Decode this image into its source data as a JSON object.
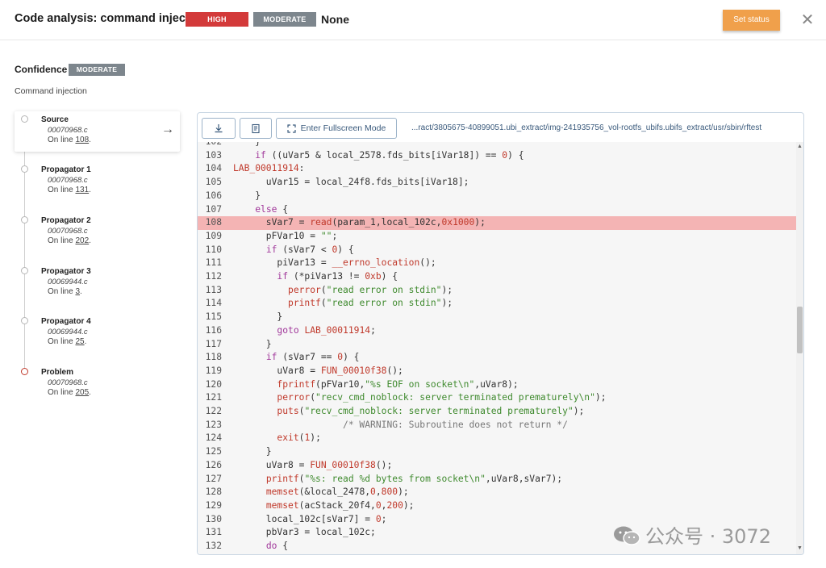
{
  "header": {
    "title": "Code analysis: command injection",
    "severity_badge": "HIGH",
    "moderate_badge": "MODERATE",
    "status_text": "None",
    "set_status_label": "Set status",
    "close_glyph": "✕"
  },
  "confidence": {
    "label": "Confidence",
    "badge": "MODERATE",
    "description": "Command injection"
  },
  "flow": {
    "items": [
      {
        "title": "Source",
        "file": "00070968.c",
        "line_prefix": "On line ",
        "line": "108",
        "active": true
      },
      {
        "title": "Propagator 1",
        "file": "00070968.c",
        "line_prefix": "On line ",
        "line": "131"
      },
      {
        "title": "Propagator 2",
        "file": "00070968.c",
        "line_prefix": "On line ",
        "line": "202"
      },
      {
        "title": "Propagator 3",
        "file": "00069944.c",
        "line_prefix": "On line ",
        "line": "3"
      },
      {
        "title": "Propagator 4",
        "file": "00069944.c",
        "line_prefix": "On line ",
        "line": "25"
      },
      {
        "title": "Problem",
        "file": "00070968.c",
        "line_prefix": "On line ",
        "line": "205"
      }
    ],
    "arrow_glyph": "→"
  },
  "toolbar": {
    "download_icon": "download-icon",
    "copy_icon": "copy-icon",
    "fullscreen_label": "Enter Fullscreen Mode",
    "path": "...ract/3805675-40899051.ubi_extract/img-241935756_vol-rootfs_ubifs.ubifs_extract/usr/sbin/rftest"
  },
  "colors": {
    "high": "#d33a3a",
    "moderate": "#7d868d",
    "set_status": "#f0a04b",
    "highlight_line": "#f4b4b4"
  },
  "code": {
    "highlight_line": 108,
    "lines": [
      {
        "n": "102",
        "t": [
          [
            "plain",
            "    }"
          ]
        ]
      },
      {
        "n": "103",
        "t": [
          [
            "plain",
            "    "
          ],
          [
            "kw",
            "if"
          ],
          [
            "plain",
            " ((uVar5 & local_2578.fds_bits[iVar18]) == "
          ],
          [
            "num",
            "0"
          ],
          [
            "plain",
            ") {"
          ]
        ]
      },
      {
        "n": "104",
        "t": [
          [
            "lbl",
            "LAB_00011914"
          ],
          [
            "plain",
            ":"
          ]
        ]
      },
      {
        "n": "105",
        "t": [
          [
            "plain",
            "      uVar15 = local_24f8.fds_bits[iVar18];"
          ]
        ]
      },
      {
        "n": "106",
        "t": [
          [
            "plain",
            "    }"
          ]
        ]
      },
      {
        "n": "107",
        "t": [
          [
            "plain",
            "    "
          ],
          [
            "kw",
            "else"
          ],
          [
            "plain",
            " {"
          ]
        ]
      },
      {
        "n": "108",
        "t": [
          [
            "plain",
            "      sVar7 = "
          ],
          [
            "fn",
            "read"
          ],
          [
            "plain",
            "(param_1,local_102c,"
          ],
          [
            "num",
            "0x1000"
          ],
          [
            "plain",
            ");"
          ]
        ]
      },
      {
        "n": "109",
        "t": [
          [
            "plain",
            "      pFVar10 = "
          ],
          [
            "str",
            "\"\""
          ],
          [
            "plain",
            ";"
          ]
        ]
      },
      {
        "n": "110",
        "t": [
          [
            "plain",
            "      "
          ],
          [
            "kw",
            "if"
          ],
          [
            "plain",
            " (sVar7 < "
          ],
          [
            "num",
            "0"
          ],
          [
            "plain",
            ") {"
          ]
        ]
      },
      {
        "n": "111",
        "t": [
          [
            "plain",
            "        piVar13 = "
          ],
          [
            "fn",
            "__errno_location"
          ],
          [
            "plain",
            "();"
          ]
        ]
      },
      {
        "n": "112",
        "t": [
          [
            "plain",
            "        "
          ],
          [
            "kw",
            "if"
          ],
          [
            "plain",
            " (*piVar13 != "
          ],
          [
            "num",
            "0xb"
          ],
          [
            "plain",
            ") {"
          ]
        ]
      },
      {
        "n": "113",
        "t": [
          [
            "plain",
            "          "
          ],
          [
            "fn",
            "perror"
          ],
          [
            "plain",
            "("
          ],
          [
            "str",
            "\"read error on stdin\""
          ],
          [
            "plain",
            ");"
          ]
        ]
      },
      {
        "n": "114",
        "t": [
          [
            "plain",
            "          "
          ],
          [
            "fn",
            "printf"
          ],
          [
            "plain",
            "("
          ],
          [
            "str",
            "\"read error on stdin\""
          ],
          [
            "plain",
            ");"
          ]
        ]
      },
      {
        "n": "115",
        "t": [
          [
            "plain",
            "        }"
          ]
        ]
      },
      {
        "n": "116",
        "t": [
          [
            "plain",
            "        "
          ],
          [
            "kw",
            "goto"
          ],
          [
            "plain",
            " "
          ],
          [
            "lbl",
            "LAB_00011914"
          ],
          [
            "plain",
            ";"
          ]
        ]
      },
      {
        "n": "117",
        "t": [
          [
            "plain",
            "      }"
          ]
        ]
      },
      {
        "n": "118",
        "t": [
          [
            "plain",
            "      "
          ],
          [
            "kw",
            "if"
          ],
          [
            "plain",
            " (sVar7 == "
          ],
          [
            "num",
            "0"
          ],
          [
            "plain",
            ") {"
          ]
        ]
      },
      {
        "n": "119",
        "t": [
          [
            "plain",
            "        uVar8 = "
          ],
          [
            "fn",
            "FUN_00010f38"
          ],
          [
            "plain",
            "();"
          ]
        ]
      },
      {
        "n": "120",
        "t": [
          [
            "plain",
            "        "
          ],
          [
            "fn",
            "fprintf"
          ],
          [
            "plain",
            "(pFVar10,"
          ],
          [
            "str",
            "\"%s EOF on socket\\n\""
          ],
          [
            "plain",
            ",uVar8);"
          ]
        ]
      },
      {
        "n": "121",
        "t": [
          [
            "plain",
            "        "
          ],
          [
            "fn",
            "perror"
          ],
          [
            "plain",
            "("
          ],
          [
            "str",
            "\"recv_cmd_noblock: server terminated prematurely\\n\""
          ],
          [
            "plain",
            ");"
          ]
        ]
      },
      {
        "n": "122",
        "t": [
          [
            "plain",
            "        "
          ],
          [
            "fn",
            "puts"
          ],
          [
            "plain",
            "("
          ],
          [
            "str",
            "\"recv_cmd_noblock: server terminated prematurely\""
          ],
          [
            "plain",
            ");"
          ]
        ]
      },
      {
        "n": "123",
        "t": [
          [
            "plain",
            "                    "
          ],
          [
            "cmt",
            "/* WARNING: Subroutine does not return */"
          ]
        ]
      },
      {
        "n": "124",
        "t": [
          [
            "plain",
            "        "
          ],
          [
            "fn",
            "exit"
          ],
          [
            "plain",
            "("
          ],
          [
            "num",
            "1"
          ],
          [
            "plain",
            ");"
          ]
        ]
      },
      {
        "n": "125",
        "t": [
          [
            "plain",
            "      }"
          ]
        ]
      },
      {
        "n": "126",
        "t": [
          [
            "plain",
            "      uVar8 = "
          ],
          [
            "fn",
            "FUN_00010f38"
          ],
          [
            "plain",
            "();"
          ]
        ]
      },
      {
        "n": "127",
        "t": [
          [
            "plain",
            "      "
          ],
          [
            "fn",
            "printf"
          ],
          [
            "plain",
            "("
          ],
          [
            "str",
            "\"%s: read %d bytes from socket\\n\""
          ],
          [
            "plain",
            ",uVar8,sVar7);"
          ]
        ]
      },
      {
        "n": "128",
        "t": [
          [
            "plain",
            "      "
          ],
          [
            "fn",
            "memset"
          ],
          [
            "plain",
            "(&local_2478,"
          ],
          [
            "num",
            "0"
          ],
          [
            "plain",
            ","
          ],
          [
            "num",
            "800"
          ],
          [
            "plain",
            ");"
          ]
        ]
      },
      {
        "n": "129",
        "t": [
          [
            "plain",
            "      "
          ],
          [
            "fn",
            "memset"
          ],
          [
            "plain",
            "(acStack_20f4,"
          ],
          [
            "num",
            "0"
          ],
          [
            "plain",
            ","
          ],
          [
            "num",
            "200"
          ],
          [
            "plain",
            ");"
          ]
        ]
      },
      {
        "n": "130",
        "t": [
          [
            "plain",
            "      local_102c[sVar7] = "
          ],
          [
            "num",
            "0"
          ],
          [
            "plain",
            ";"
          ]
        ]
      },
      {
        "n": "131",
        "t": [
          [
            "plain",
            "      pbVar3 = local_102c;"
          ]
        ]
      },
      {
        "n": "132",
        "t": [
          [
            "plain",
            "      "
          ],
          [
            "kw",
            "do"
          ],
          [
            "plain",
            " {"
          ]
        ]
      }
    ]
  },
  "watermark": {
    "icon": "wechat-icon",
    "text": "公众号 · 3072"
  }
}
